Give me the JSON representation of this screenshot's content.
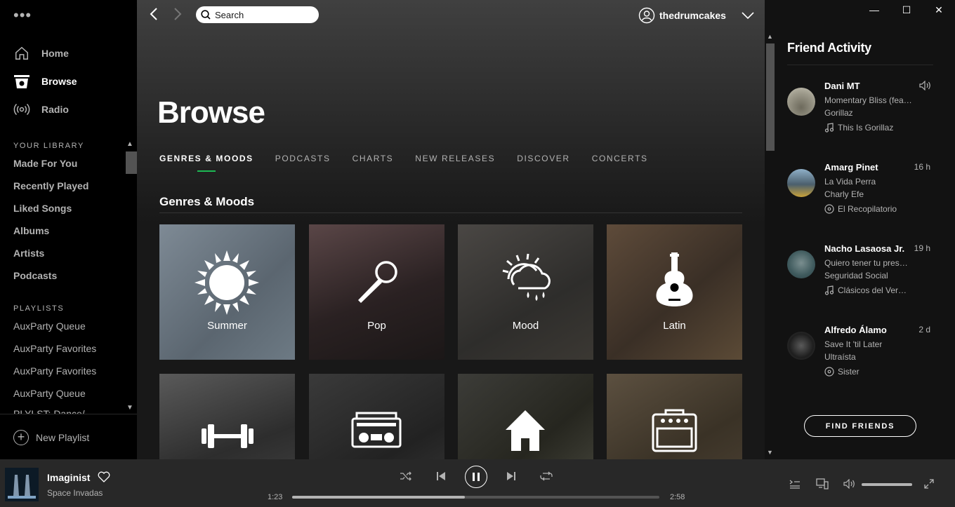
{
  "sidebar": {
    "menu_icon": "more-dots-icon",
    "nav": [
      {
        "label": "Home",
        "icon": "home-icon"
      },
      {
        "label": "Browse",
        "icon": "browse-icon"
      },
      {
        "label": "Radio",
        "icon": "radio-icon"
      }
    ],
    "library_title": "YOUR LIBRARY",
    "library": [
      "Made For You",
      "Recently Played",
      "Liked Songs",
      "Albums",
      "Artists",
      "Podcasts"
    ],
    "playlists_title": "PLAYLISTS",
    "playlists": [
      "AuxParty Queue",
      "AuxParty Favorites",
      "AuxParty Favorites",
      "AuxParty Queue",
      "PLYLST: Dance/..."
    ],
    "new_playlist": "New Playlist"
  },
  "topbar": {
    "search_placeholder": "Search",
    "username": "thedrumcakes"
  },
  "main": {
    "title": "Browse",
    "tabs": [
      "GENRES & MOODS",
      "PODCASTS",
      "CHARTS",
      "NEW RELEASES",
      "DISCOVER",
      "CONCERTS"
    ],
    "active_tab": 0,
    "section_title": "Genres & Moods",
    "tiles": [
      {
        "label": "Summer",
        "icon": "sun-icon",
        "bg": "#6f7b86"
      },
      {
        "label": "Pop",
        "icon": "microphone-icon",
        "bg": "#3a2d2e"
      },
      {
        "label": "Mood",
        "icon": "weather-icon",
        "bg": "#3d3b38"
      },
      {
        "label": "Latin",
        "icon": "guitar-icon",
        "bg": "#4c3c30"
      },
      {
        "label": "",
        "icon": "dumbbell-icon",
        "bg": "#3b3a3a"
      },
      {
        "label": "",
        "icon": "boombox-icon",
        "bg": "#2e2e2e"
      },
      {
        "label": "",
        "icon": "house-icon",
        "bg": "#3a3a36"
      },
      {
        "label": "",
        "icon": "amplifier-icon",
        "bg": "#4a4034"
      }
    ]
  },
  "friends": {
    "title": "Friend Activity",
    "items": [
      {
        "name": "Dani MT",
        "time": "",
        "track": "Momentary Bliss (feat. slowthai and Slaves)",
        "artist": "Gorillaz",
        "context": "This Is Gorillaz",
        "context_icon": "music-note-icon",
        "avatar": "#8a8a7a",
        "playing": true
      },
      {
        "name": "Amarg Pinet",
        "time": "16 h",
        "track": "La Vida Perra",
        "artist": "Charly Efe",
        "context": "El Recopilatorio",
        "context_icon": "album-icon",
        "avatar": "#5a6e7c",
        "playing": false
      },
      {
        "name": "Nacho Lasaosa Jr.",
        "time": "19 h",
        "track": "Quiero tener tu presencia",
        "artist": "Seguridad Social",
        "context": "Clásicos del Verano",
        "context_icon": "music-note-icon",
        "avatar": "#4d6a6e",
        "playing": false
      },
      {
        "name": "Alfredo Álamo",
        "time": "2 d",
        "track": "Save It 'til Later",
        "artist": "Ultraísta",
        "context": "Sister",
        "context_icon": "album-icon",
        "avatar": "#2b2b2b",
        "playing": false
      }
    ],
    "find_button": "FIND FRIENDS"
  },
  "player": {
    "title": "Imaginist",
    "artist": "Space Invadas",
    "elapsed": "1:23",
    "duration": "2:58",
    "progress": 0.47,
    "volume": 1.0
  }
}
